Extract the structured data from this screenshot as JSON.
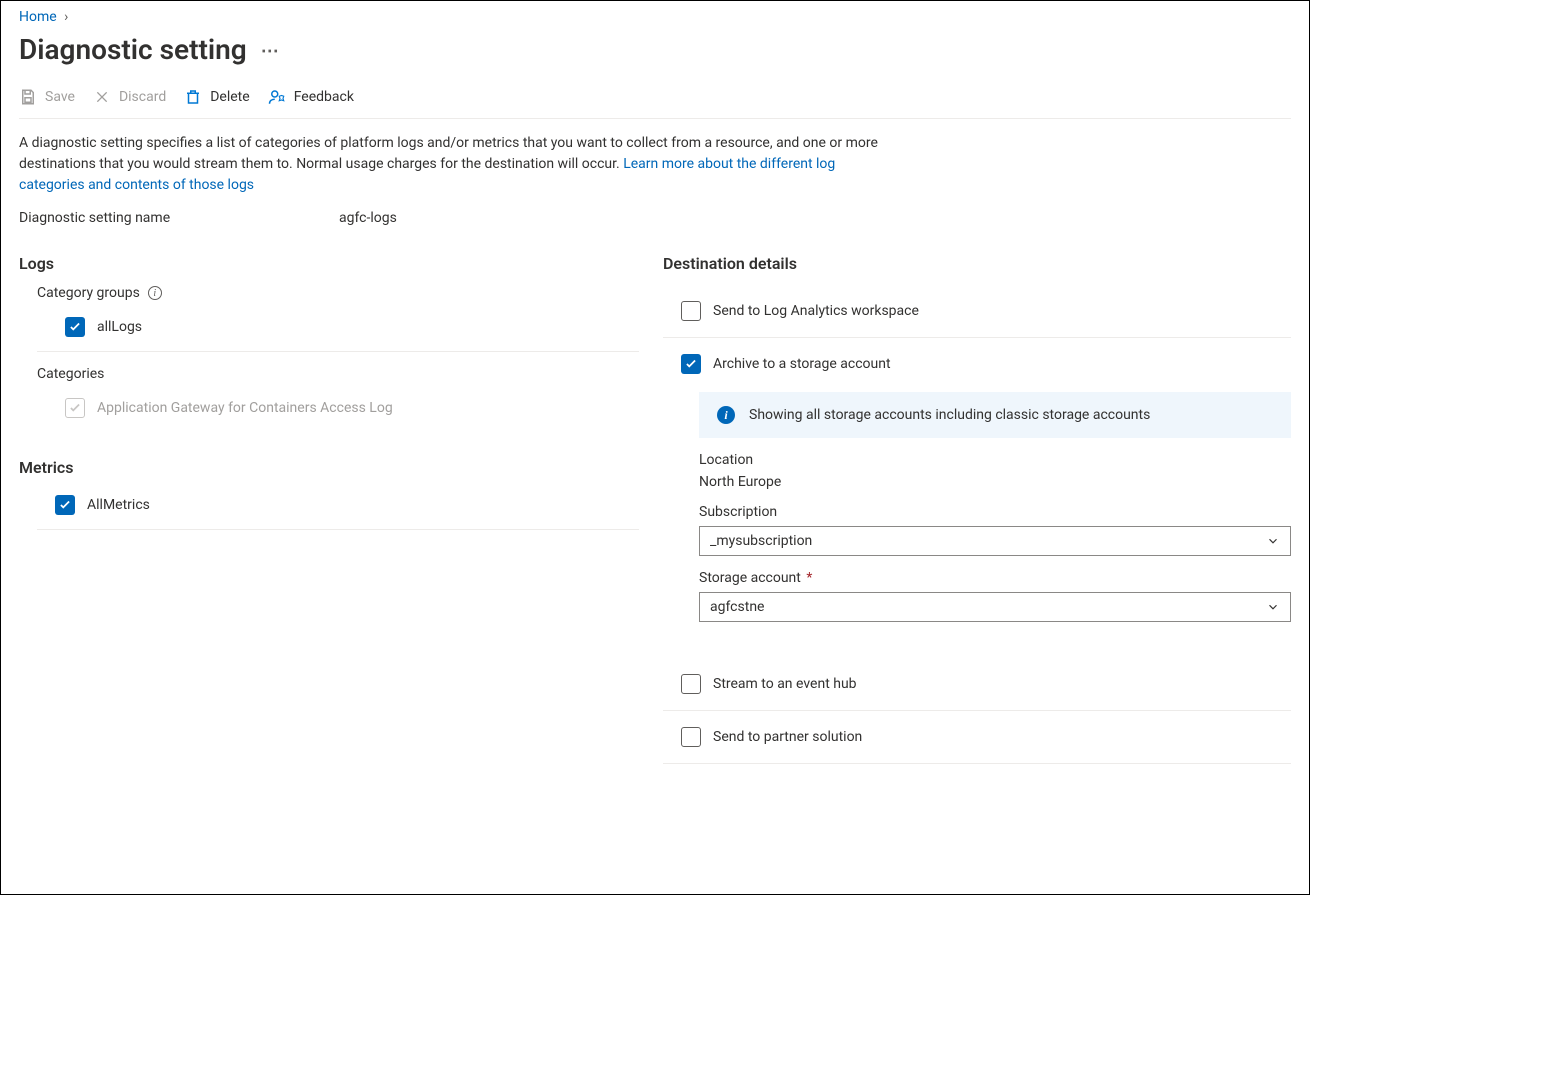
{
  "breadcrumb": {
    "home": "Home"
  },
  "title": "Diagnostic setting",
  "toolbar": {
    "save": "Save",
    "discard": "Discard",
    "delete": "Delete",
    "feedback": "Feedback"
  },
  "intro": {
    "text_a": "A diagnostic setting specifies a list of categories of platform logs and/or metrics that you want to collect from a resource, and one or more destinations that you would stream them to. Normal usage charges for the destination will occur. ",
    "link": "Learn more about the different log categories and contents of those logs"
  },
  "name_row": {
    "label": "Diagnostic setting name",
    "value": "agfc-logs"
  },
  "logs": {
    "header": "Logs",
    "category_groups_label": "Category groups",
    "all_logs": "allLogs",
    "categories_label": "Categories",
    "cat1": "Application Gateway for Containers Access Log"
  },
  "metrics": {
    "header": "Metrics",
    "all_metrics": "AllMetrics"
  },
  "dest": {
    "header": "Destination details",
    "law": "Send to Log Analytics workspace",
    "storage": "Archive to a storage account",
    "banner": "Showing all storage accounts including classic storage accounts",
    "location_label": "Location",
    "location_value": "North Europe",
    "subscription_label": "Subscription",
    "subscription_value": "_mysubscription",
    "storage_label": "Storage account",
    "storage_value": "agfcstne",
    "eventhub": "Stream to an event hub",
    "partner": "Send to partner solution"
  }
}
